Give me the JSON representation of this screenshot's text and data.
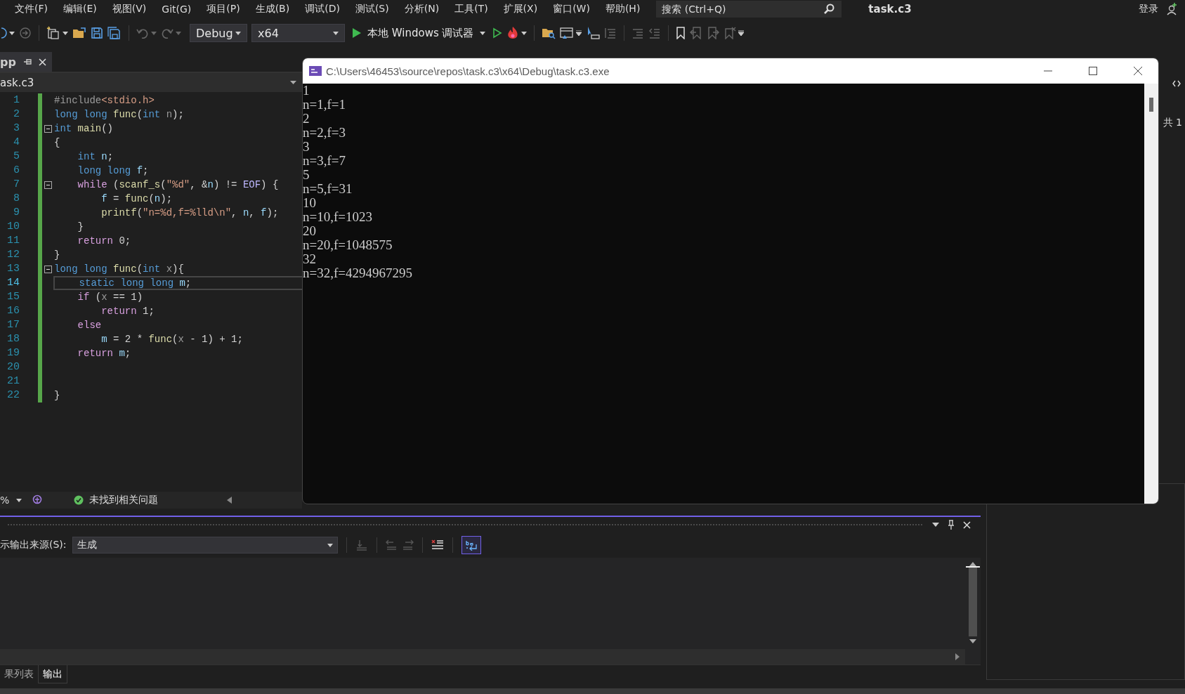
{
  "menu": [
    "文件(F)",
    "编辑(E)",
    "视图(V)",
    "Git(G)",
    "项目(P)",
    "生成(B)",
    "调试(D)",
    "测试(S)",
    "分析(N)",
    "工具(T)",
    "扩展(X)",
    "窗口(W)",
    "帮助(H)"
  ],
  "search": {
    "placeholder": "搜索 (Ctrl+Q)"
  },
  "solution_name": "task.c3",
  "sign_in": "登录",
  "toolbar": {
    "configuration": "Debug",
    "platform": "x64",
    "run_label": "本地 Windows 调试器"
  },
  "document_tab": {
    "label": "pp"
  },
  "nav_bar": {
    "file": "ask.c3"
  },
  "editor": {
    "lines": [
      {
        "number": "1",
        "fold": false,
        "current": false,
        "tokens": [
          {
            "text": "#include",
            "kind": "preproc"
          },
          {
            "text": "<stdio.h>",
            "kind": "string"
          }
        ]
      },
      {
        "number": "2",
        "fold": false,
        "current": false,
        "tokens": [
          {
            "text": "long long ",
            "kind": "keyword"
          },
          {
            "text": "func",
            "kind": "func"
          },
          {
            "text": "(",
            "kind": "plain"
          },
          {
            "text": "int ",
            "kind": "keyword"
          },
          {
            "text": "n",
            "kind": "param"
          },
          {
            "text": ");",
            "kind": "plain"
          }
        ]
      },
      {
        "number": "3",
        "fold": true,
        "current": false,
        "tokens": [
          {
            "text": "int ",
            "kind": "keyword"
          },
          {
            "text": "main",
            "kind": "func"
          },
          {
            "text": "()",
            "kind": "plain"
          }
        ]
      },
      {
        "number": "4",
        "fold": false,
        "current": false,
        "tokens": [
          {
            "text": "{",
            "kind": "plain"
          }
        ]
      },
      {
        "number": "5",
        "fold": false,
        "current": false,
        "tokens": [
          {
            "text": "    int ",
            "kind": "keyword"
          },
          {
            "text": "n",
            "kind": "var"
          },
          {
            "text": ";",
            "kind": "plain"
          }
        ]
      },
      {
        "number": "6",
        "fold": false,
        "current": false,
        "tokens": [
          {
            "text": "    long long ",
            "kind": "keyword"
          },
          {
            "text": "f",
            "kind": "var"
          },
          {
            "text": ";",
            "kind": "plain"
          }
        ]
      },
      {
        "number": "7",
        "fold": true,
        "current": false,
        "tokens": [
          {
            "text": "    while ",
            "kind": "control"
          },
          {
            "text": "(",
            "kind": "plain"
          },
          {
            "text": "scanf_s",
            "kind": "func"
          },
          {
            "text": "(",
            "kind": "plain"
          },
          {
            "text": "\"%d\"",
            "kind": "string"
          },
          {
            "text": ", &",
            "kind": "plain"
          },
          {
            "text": "n",
            "kind": "var"
          },
          {
            "text": ") != ",
            "kind": "plain"
          },
          {
            "text": "EOF",
            "kind": "macro"
          },
          {
            "text": ") {",
            "kind": "plain"
          }
        ]
      },
      {
        "number": "8",
        "fold": false,
        "current": false,
        "tokens": [
          {
            "text": "        f",
            "kind": "var"
          },
          {
            "text": " = ",
            "kind": "plain"
          },
          {
            "text": "func",
            "kind": "func"
          },
          {
            "text": "(",
            "kind": "plain"
          },
          {
            "text": "n",
            "kind": "var"
          },
          {
            "text": ");",
            "kind": "plain"
          }
        ]
      },
      {
        "number": "9",
        "fold": false,
        "current": false,
        "tokens": [
          {
            "text": "        printf",
            "kind": "func"
          },
          {
            "text": "(",
            "kind": "plain"
          },
          {
            "text": "\"n=%d,f=%lld\\n\"",
            "kind": "string"
          },
          {
            "text": ", ",
            "kind": "plain"
          },
          {
            "text": "n",
            "kind": "var"
          },
          {
            "text": ", ",
            "kind": "plain"
          },
          {
            "text": "f",
            "kind": "var"
          },
          {
            "text": ");",
            "kind": "plain"
          }
        ]
      },
      {
        "number": "10",
        "fold": false,
        "current": false,
        "tokens": [
          {
            "text": "    }",
            "kind": "plain"
          }
        ]
      },
      {
        "number": "11",
        "fold": false,
        "current": false,
        "tokens": [
          {
            "text": "    return ",
            "kind": "control"
          },
          {
            "text": "0;",
            "kind": "plain"
          }
        ]
      },
      {
        "number": "12",
        "fold": false,
        "current": false,
        "tokens": [
          {
            "text": "}",
            "kind": "plain"
          }
        ]
      },
      {
        "number": "13",
        "fold": true,
        "current": false,
        "tokens": [
          {
            "text": "long long ",
            "kind": "keyword"
          },
          {
            "text": "func",
            "kind": "func"
          },
          {
            "text": "(",
            "kind": "plain"
          },
          {
            "text": "int ",
            "kind": "keyword"
          },
          {
            "text": "x",
            "kind": "param"
          },
          {
            "text": "){",
            "kind": "plain"
          }
        ]
      },
      {
        "number": "14",
        "fold": false,
        "current": true,
        "tokens": [
          {
            "text": "    static long long ",
            "kind": "keyword"
          },
          {
            "text": "m",
            "kind": "var"
          },
          {
            "text": ";",
            "kind": "plain"
          }
        ]
      },
      {
        "number": "15",
        "fold": false,
        "current": false,
        "tokens": [
          {
            "text": "    if ",
            "kind": "control"
          },
          {
            "text": "(",
            "kind": "plain"
          },
          {
            "text": "x",
            "kind": "param"
          },
          {
            "text": " == 1)",
            "kind": "plain"
          }
        ]
      },
      {
        "number": "16",
        "fold": false,
        "current": false,
        "tokens": [
          {
            "text": "        return ",
            "kind": "control"
          },
          {
            "text": "1;",
            "kind": "plain"
          }
        ]
      },
      {
        "number": "17",
        "fold": false,
        "current": false,
        "tokens": [
          {
            "text": "    else",
            "kind": "control"
          }
        ]
      },
      {
        "number": "18",
        "fold": false,
        "current": false,
        "tokens": [
          {
            "text": "        m",
            "kind": "var"
          },
          {
            "text": " = 2 * ",
            "kind": "plain"
          },
          {
            "text": "func",
            "kind": "func"
          },
          {
            "text": "(",
            "kind": "plain"
          },
          {
            "text": "x",
            "kind": "param"
          },
          {
            "text": " - 1) + 1;",
            "kind": "plain"
          }
        ]
      },
      {
        "number": "19",
        "fold": false,
        "current": false,
        "tokens": [
          {
            "text": "    return ",
            "kind": "control"
          },
          {
            "text": "m",
            "kind": "var"
          },
          {
            "text": ";",
            "kind": "plain"
          }
        ]
      },
      {
        "number": "20",
        "fold": false,
        "current": false
      },
      {
        "number": "21",
        "fold": false,
        "current": false
      },
      {
        "number": "22",
        "fold": false,
        "current": false,
        "tokens": [
          {
            "text": "}",
            "kind": "plain"
          }
        ]
      }
    ]
  },
  "editor_status": {
    "zoom": "%",
    "issues": "未找到相关问题"
  },
  "console": {
    "title": "C:\\Users\\46453\\source\\repos\\task.c3\\x64\\Debug\\task.c3.exe",
    "lines": [
      "1",
      "n=1,f=1",
      "2",
      "n=2,f=3",
      "3",
      "n=3,f=7",
      "5",
      "n=5,f=31",
      "10",
      "n=10,f=1023",
      "20",
      "n=20,f=1048575",
      "32",
      "n=32,f=4294967295"
    ]
  },
  "output_panel": {
    "source_label": "示输出来源(S):",
    "source": "生成",
    "word_wrap_on": true
  },
  "bottom_tabs": [
    {
      "label": "果列表",
      "selected": false
    },
    {
      "label": "输出",
      "selected": true
    }
  ],
  "right_panel": {
    "count_text": "共 1"
  }
}
